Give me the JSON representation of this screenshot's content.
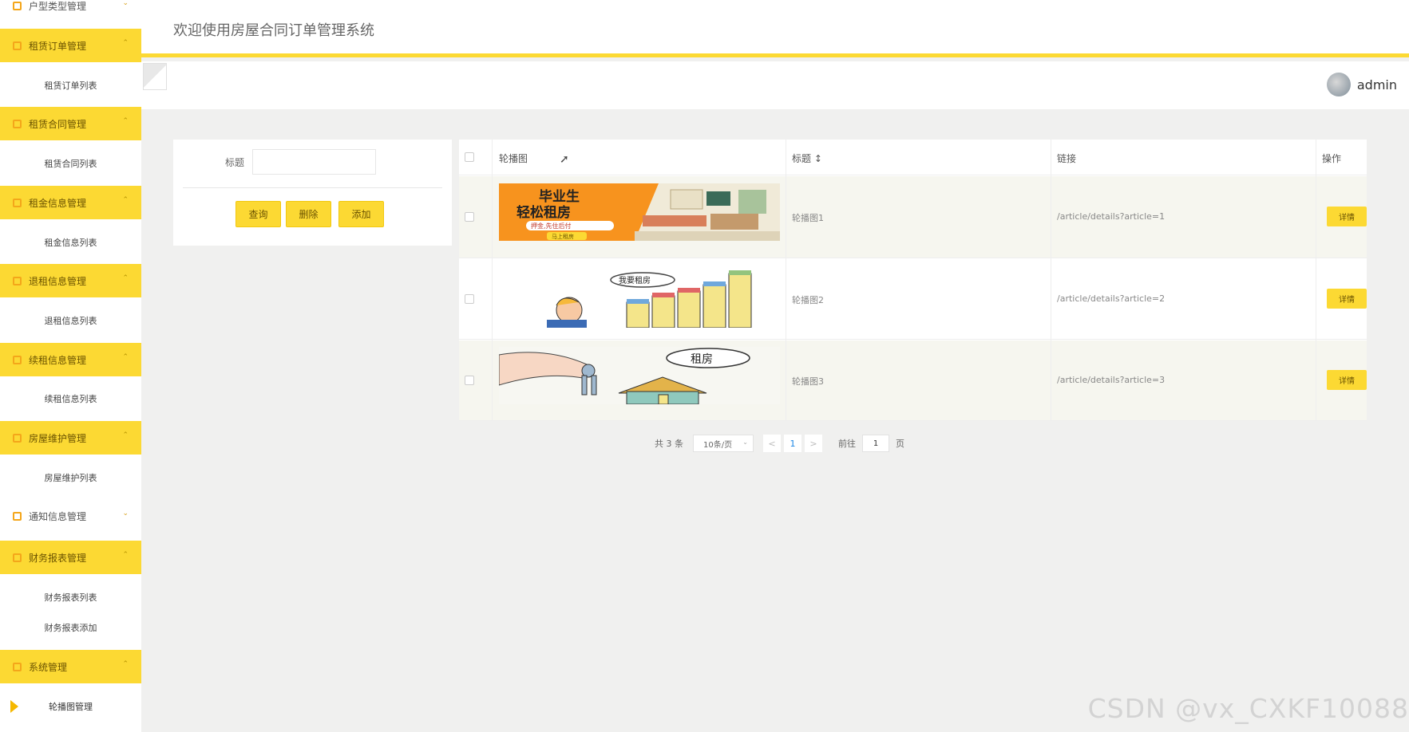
{
  "sidebar": {
    "groups": [
      {
        "label": "户型类型管理"
      },
      {
        "label": "租赁订单管理",
        "sub": "租赁订单列表"
      },
      {
        "label": "租赁合同管理",
        "sub": "租赁合同列表"
      },
      {
        "label": "租金信息管理",
        "sub": "租金信息列表"
      },
      {
        "label": "退租信息管理",
        "sub": "退租信息列表"
      },
      {
        "label": "续租信息管理",
        "sub": "续租信息列表"
      },
      {
        "label": "房屋维护管理",
        "sub": "房屋维护列表"
      },
      {
        "label": "通知信息管理"
      },
      {
        "label": "财务报表管理",
        "subs": [
          "财务报表列表",
          "财务报表添加"
        ]
      },
      {
        "label": "系统管理",
        "sub": "轮播图管理"
      }
    ]
  },
  "header": {
    "welcome": "欢迎使用房屋合同订单管理系统",
    "user": "admin"
  },
  "search": {
    "title_label": "标题",
    "title_value": "",
    "query_btn": "查询",
    "delete_btn": "删除",
    "add_btn": "添加"
  },
  "table": {
    "headers": {
      "image": "轮播图",
      "title": "标题 ↕",
      "link": "链接",
      "action": "操作"
    },
    "rows": [
      {
        "title": "轮播图1",
        "link": "/article/details?article=1",
        "action": "详情",
        "banner": {
          "line1": "毕业生",
          "line2": "轻松租房",
          "line3": "押金,先住后付",
          "tag": "马上租房"
        }
      },
      {
        "title": "轮播图2",
        "link": "/article/details?article=2",
        "action": "详情",
        "banner": {
          "bubble": "我要租房"
        }
      },
      {
        "title": "轮播图3",
        "link": "/article/details?article=3",
        "action": "详情",
        "banner": {
          "bubble": "租房"
        }
      }
    ]
  },
  "pagination": {
    "total": "共 3 条",
    "page_size": "10条/页",
    "prev": "<",
    "current": "1",
    "next": ">",
    "goto_label": "前往",
    "goto_value": "1",
    "page_suffix": "页"
  },
  "watermark": "CSDN @vx_CXKF10088",
  "colors": {
    "accent": "#fcd933",
    "sidebar_bg": "#ffffff",
    "page_bg": "#f0f0ef"
  },
  "icons": {
    "menu": "square-outline-icon",
    "collapse": "chevron-up-icon",
    "expand": "chevron-down-icon",
    "sort": "sort-icon"
  }
}
